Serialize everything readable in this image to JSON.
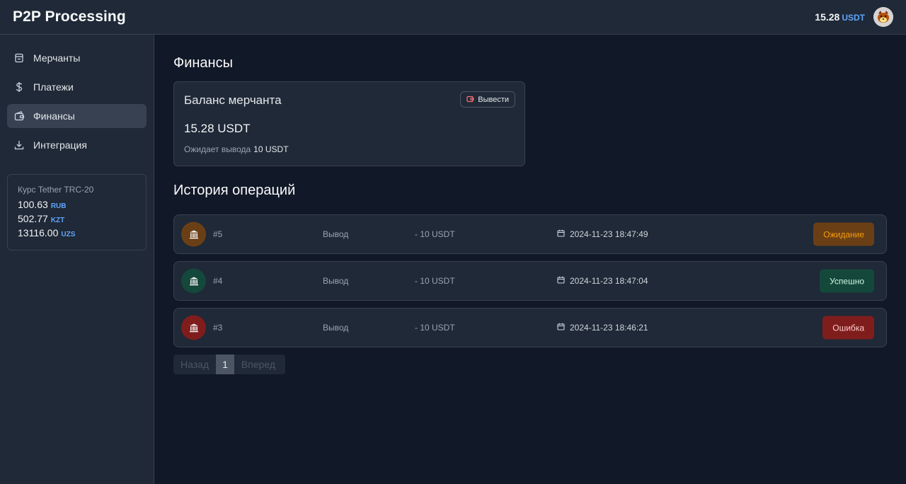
{
  "header": {
    "title": "P2P Processing",
    "balance": "15.28",
    "currency": "USDT",
    "avatar_icon": "avatar-icon"
  },
  "sidebar": {
    "items": [
      {
        "label": "Мерчанты",
        "icon": "store-icon"
      },
      {
        "label": "Платежи",
        "icon": "dollar-icon"
      },
      {
        "label": "Финансы",
        "icon": "wallet-icon",
        "active": true
      },
      {
        "label": "Интеграция",
        "icon": "download-icon"
      }
    ],
    "rates": {
      "title": "Курс Tether TRC-20",
      "items": [
        {
          "value": "100.63",
          "currency": "RUB"
        },
        {
          "value": "502.77",
          "currency": "KZT"
        },
        {
          "value": "13116.00",
          "currency": "UZS"
        }
      ]
    }
  },
  "main": {
    "title": "Финансы",
    "balance_card": {
      "label": "Баланс мерчанта",
      "withdraw_label": "Вывести",
      "amount": "15.28 USDT",
      "pending_label": "Ожидает вывода",
      "pending_value": "10 USDT"
    },
    "history_title": "История операций",
    "operations": [
      {
        "id": "#5",
        "type": "Вывод",
        "amount": "- 10 USDT",
        "date": "2024-11-23 18:47:49",
        "status": "Ожидание",
        "status_kind": "pending"
      },
      {
        "id": "#4",
        "type": "Вывод",
        "amount": "- 10 USDT",
        "date": "2024-11-23 18:47:04",
        "status": "Успешно",
        "status_kind": "success"
      },
      {
        "id": "#3",
        "type": "Вывод",
        "amount": "- 10 USDT",
        "date": "2024-11-23 18:46:21",
        "status": "Ошибка",
        "status_kind": "error"
      }
    ],
    "pagination": {
      "prev": "Назад",
      "page": "1",
      "next": "Вперед"
    }
  },
  "colors": {
    "pending_bg": "#6b3f16",
    "pending_fg": "#f59e0b",
    "success_bg": "#14483b",
    "success_fg": "#d1fae5",
    "error_bg": "#7f1d1d",
    "error_fg": "#fecaca",
    "accent": "#60a5fa"
  }
}
